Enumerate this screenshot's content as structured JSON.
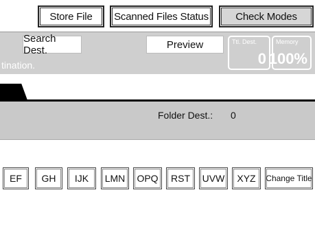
{
  "header": {
    "tabs": [
      {
        "label": "Store File"
      },
      {
        "label": "Scanned Files Status"
      },
      {
        "label": "Check Modes"
      }
    ]
  },
  "controls": {
    "search_label": "Search Dest.",
    "preview_label": "Preview",
    "subtitle": "tination.",
    "total_dest": {
      "caption": "Ttl. Dest.",
      "value": "0"
    },
    "memory": {
      "caption": "Memory",
      "value": "100%"
    }
  },
  "folder": {
    "label": "Folder Dest.:",
    "value": "0"
  },
  "letters": [
    "EF",
    "GH",
    "IJK",
    "LMN",
    "OPQ",
    "RST",
    "UVW",
    "XYZ",
    "Change Title"
  ]
}
